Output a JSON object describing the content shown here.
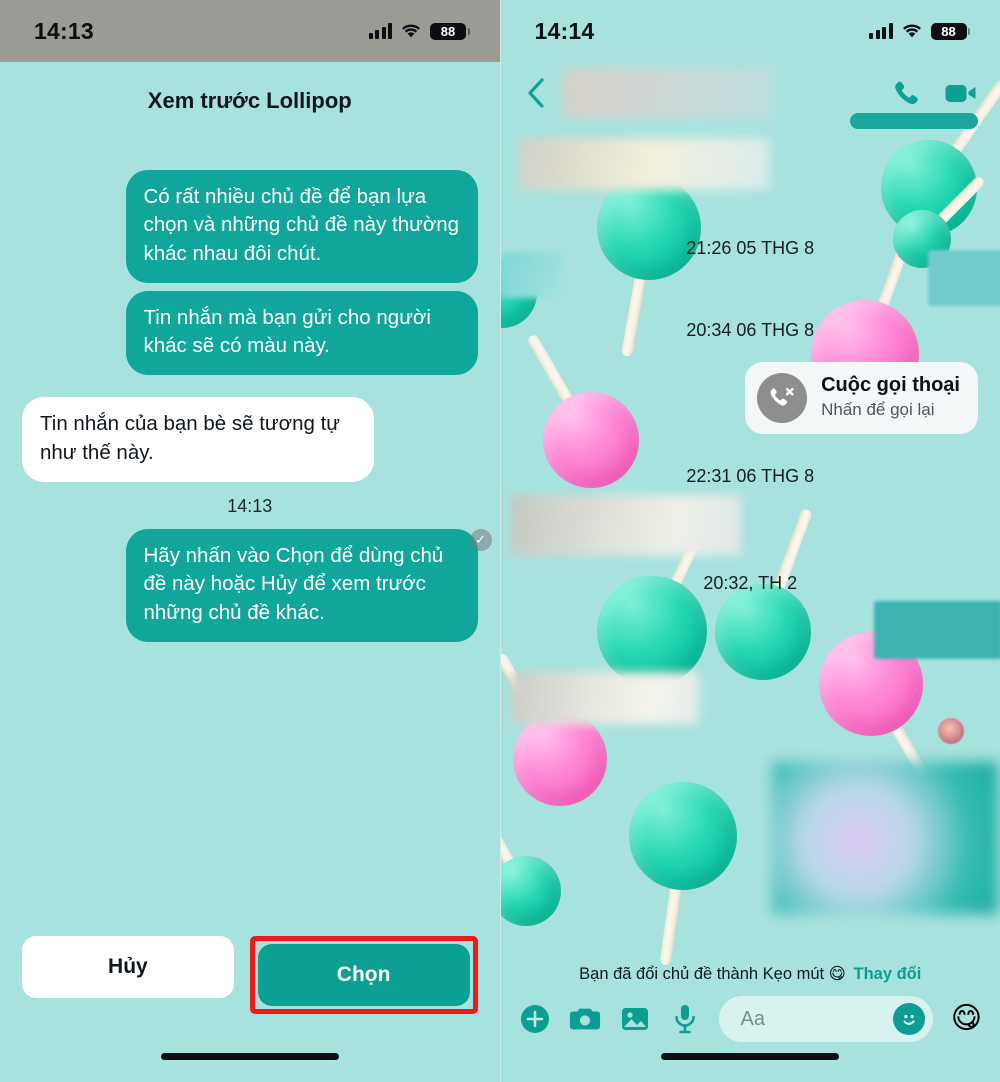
{
  "left": {
    "status": {
      "time": "14:13",
      "battery": "88",
      "signal_icon": "cellular-signal-icon",
      "wifi_icon": "wifi-icon",
      "battery_icon": "battery-icon"
    },
    "sheet_title": "Xem trước Lollipop",
    "messages": [
      {
        "side": "out",
        "text": "Có rất nhiều chủ đề để bạn lựa chọn và những chủ đề này thường khác nhau đôi chút."
      },
      {
        "side": "out",
        "text": "Tin nhắn mà bạn gửi cho người khác sẽ có màu này."
      },
      {
        "side": "in",
        "text": "Tin nhắn của bạn bè sẽ tương tự như thế này."
      }
    ],
    "timestamp": "14:13",
    "last_message": "Hãy nhấn vào Chọn để dùng chủ đề này hoặc Hủy để xem trước những chủ đề khác.",
    "seen_icon": "check-circle-icon",
    "buttons": {
      "cancel": "Hủy",
      "confirm": "Chọn"
    },
    "highlight_color": "#ec1c18"
  },
  "right": {
    "status": {
      "time": "14:14",
      "battery": "88",
      "signal_icon": "cellular-signal-icon",
      "wifi_icon": "wifi-icon",
      "battery_icon": "battery-icon"
    },
    "header": {
      "back_icon": "back-chevron-icon",
      "name_redacted": "",
      "call_icon": "phone-call-icon",
      "video_icon": "video-camera-icon"
    },
    "timestamps": [
      "21:26 05 THG 8",
      "20:34 06 THG 8",
      "22:31 06 THG 8",
      "20:32, TH 2"
    ],
    "call_card": {
      "icon": "missed-call-icon",
      "title": "Cuộc gọi thoại",
      "subtitle": "Nhấn để gọi lại"
    },
    "theme_note": {
      "text": "Bạn đã đổi chủ đề thành Kẹo mút 😋",
      "link": "Thay đổi"
    },
    "composer": {
      "plus_icon": "plus-circle-icon",
      "camera_icon": "camera-icon",
      "gallery_icon": "image-icon",
      "mic_icon": "microphone-icon",
      "placeholder": "Aa",
      "sticker_icon": "smiley-sticker-icon",
      "emoji": "😋"
    }
  },
  "theme": {
    "background": "#a8e2de",
    "bubble_out": "#11a69b",
    "bubble_in": "#ffffff",
    "accent": "#0d9e92",
    "lolly_green": "#1ed2ae",
    "lolly_pink": "#fd75cc"
  }
}
